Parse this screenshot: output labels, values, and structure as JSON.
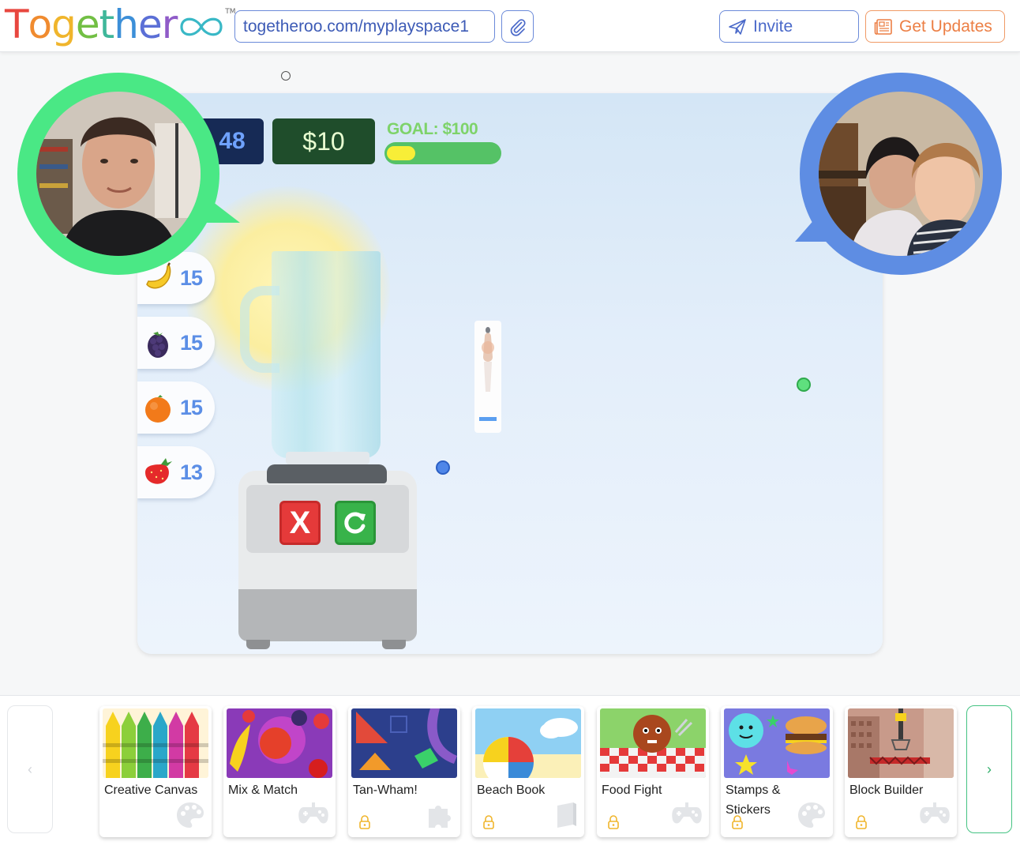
{
  "header": {
    "logo_letters": [
      {
        "ch": "T",
        "color": "#e8473f"
      },
      {
        "ch": "o",
        "color": "#f08b2f"
      },
      {
        "ch": "g",
        "color": "#f0b52c"
      },
      {
        "ch": "e",
        "color": "#72bf44"
      },
      {
        "ch": "t",
        "color": "#3fb79a"
      },
      {
        "ch": "h",
        "color": "#3c8fd8"
      },
      {
        "ch": "e",
        "color": "#5b6fd6"
      },
      {
        "ch": "r",
        "color": "#8f5bc8"
      }
    ],
    "logo_infinity_color": "#39b8c6",
    "logo_tm": "TM",
    "url": "togetheroo.com/myplayspace1",
    "invite_label": "Invite",
    "updates_label": "Get Updates"
  },
  "game": {
    "score": "48",
    "money": "$10",
    "goal_label": "GOAL: $100",
    "goal_progress": 0.12,
    "fruits": [
      {
        "name": "banana",
        "count": "15"
      },
      {
        "name": "blackberry",
        "count": "15"
      },
      {
        "name": "orange",
        "count": "15"
      },
      {
        "name": "strawberry",
        "count": "13"
      }
    ],
    "cancel_label": "X"
  },
  "tray": {
    "games": [
      {
        "title": "Creative Canvas",
        "locked": false,
        "type": "palette-icon"
      },
      {
        "title": "Mix & Match",
        "locked": false,
        "type": "gamepad-icon"
      },
      {
        "title": "Tan-Wham!",
        "locked": true,
        "type": "puzzle-icon"
      },
      {
        "title": "Beach Book",
        "locked": true,
        "type": "book-icon"
      },
      {
        "title": "Food Fight",
        "locked": true,
        "type": "gamepad-icon"
      },
      {
        "title": "Stamps & Stickers",
        "locked": true,
        "type": "palette-icon"
      },
      {
        "title": "Block Builder",
        "locked": true,
        "type": "gamepad-icon"
      }
    ],
    "prev_label": "‹",
    "next_label": "›"
  },
  "colors": {
    "accent_blue": "#5e8de3",
    "accent_green": "#4ae885",
    "updates_orange": "#ec7f45"
  }
}
